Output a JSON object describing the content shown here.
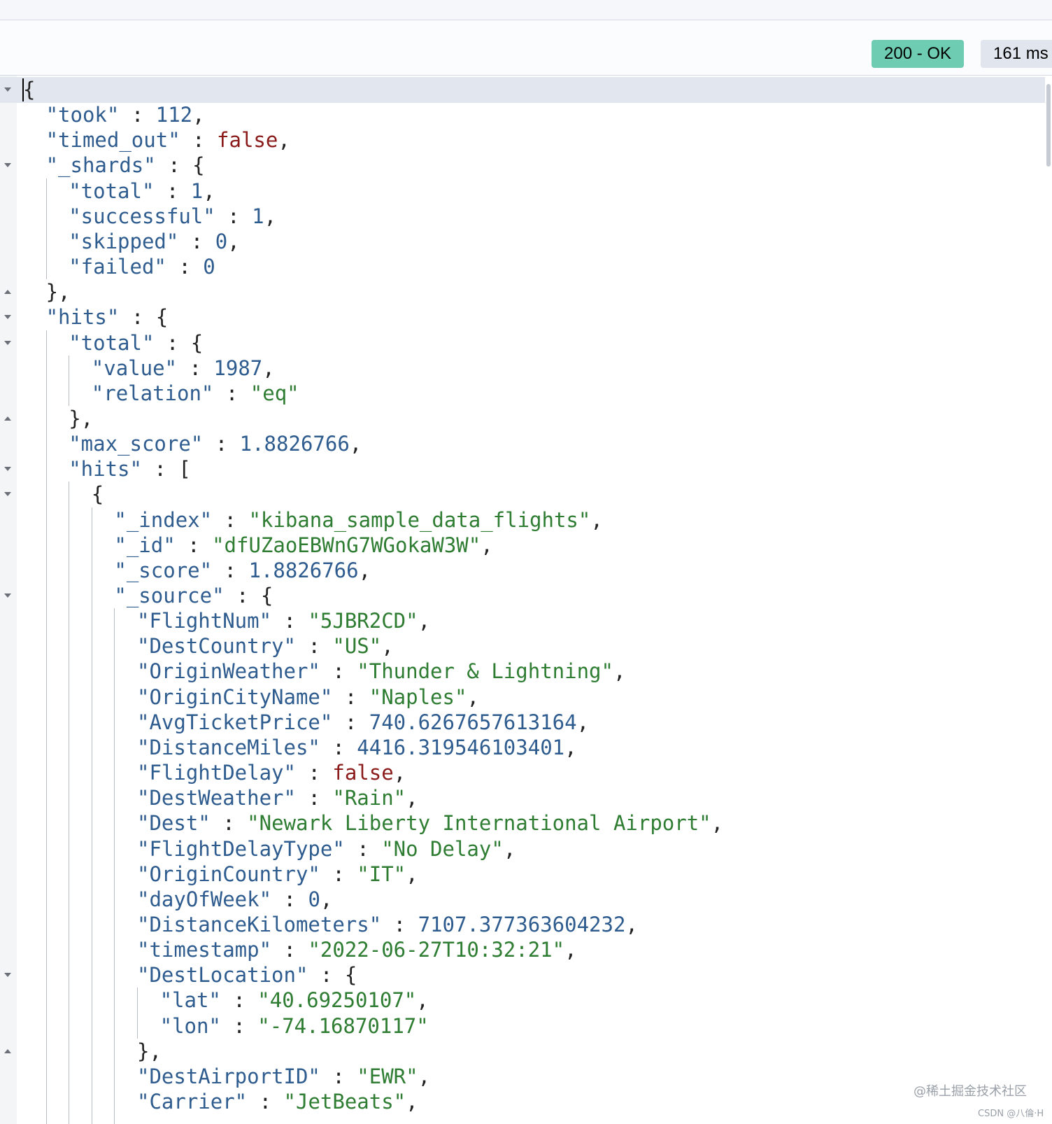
{
  "status": {
    "code_label": "200 - OK",
    "time_label": "161 ms"
  },
  "response": {
    "lines": [
      [
        [
          "p",
          "{"
        ]
      ],
      [
        [
          "k",
          "\"took\""
        ],
        [
          "p",
          " : "
        ],
        [
          "n",
          "112"
        ],
        [
          "p",
          ","
        ]
      ],
      [
        [
          "k",
          "\"timed_out\""
        ],
        [
          "p",
          " : "
        ],
        [
          "b",
          "false"
        ],
        [
          "p",
          ","
        ]
      ],
      [
        [
          "k",
          "\"_shards\""
        ],
        [
          "p",
          " : {"
        ]
      ],
      [
        [
          "k",
          "\"total\""
        ],
        [
          "p",
          " : "
        ],
        [
          "n",
          "1"
        ],
        [
          "p",
          ","
        ]
      ],
      [
        [
          "k",
          "\"successful\""
        ],
        [
          "p",
          " : "
        ],
        [
          "n",
          "1"
        ],
        [
          "p",
          ","
        ]
      ],
      [
        [
          "k",
          "\"skipped\""
        ],
        [
          "p",
          " : "
        ],
        [
          "n",
          "0"
        ],
        [
          "p",
          ","
        ]
      ],
      [
        [
          "k",
          "\"failed\""
        ],
        [
          "p",
          " : "
        ],
        [
          "n",
          "0"
        ]
      ],
      [
        [
          "p",
          "},"
        ]
      ],
      [
        [
          "k",
          "\"hits\""
        ],
        [
          "p",
          " : {"
        ]
      ],
      [
        [
          "k",
          "\"total\""
        ],
        [
          "p",
          " : {"
        ]
      ],
      [
        [
          "k",
          "\"value\""
        ],
        [
          "p",
          " : "
        ],
        [
          "n",
          "1987"
        ],
        [
          "p",
          ","
        ]
      ],
      [
        [
          "k",
          "\"relation\""
        ],
        [
          "p",
          " : "
        ],
        [
          "s",
          "\"eq\""
        ]
      ],
      [
        [
          "p",
          "},"
        ]
      ],
      [
        [
          "k",
          "\"max_score\""
        ],
        [
          "p",
          " : "
        ],
        [
          "n",
          "1.8826766"
        ],
        [
          "p",
          ","
        ]
      ],
      [
        [
          "k",
          "\"hits\""
        ],
        [
          "p",
          " : ["
        ]
      ],
      [
        [
          "p",
          "{"
        ]
      ],
      [
        [
          "k",
          "\"_index\""
        ],
        [
          "p",
          " : "
        ],
        [
          "s",
          "\"kibana_sample_data_flights\""
        ],
        [
          "p",
          ","
        ]
      ],
      [
        [
          "k",
          "\"_id\""
        ],
        [
          "p",
          " : "
        ],
        [
          "s",
          "\"dfUZaoEBWnG7WGokaW3W\""
        ],
        [
          "p",
          ","
        ]
      ],
      [
        [
          "k",
          "\"_score\""
        ],
        [
          "p",
          " : "
        ],
        [
          "n",
          "1.8826766"
        ],
        [
          "p",
          ","
        ]
      ],
      [
        [
          "k",
          "\"_source\""
        ],
        [
          "p",
          " : {"
        ]
      ],
      [
        [
          "k",
          "\"FlightNum\""
        ],
        [
          "p",
          " : "
        ],
        [
          "s",
          "\"5JBR2CD\""
        ],
        [
          "p",
          ","
        ]
      ],
      [
        [
          "k",
          "\"DestCountry\""
        ],
        [
          "p",
          " : "
        ],
        [
          "s",
          "\"US\""
        ],
        [
          "p",
          ","
        ]
      ],
      [
        [
          "k",
          "\"OriginWeather\""
        ],
        [
          "p",
          " : "
        ],
        [
          "s",
          "\"Thunder & Lightning\""
        ],
        [
          "p",
          ","
        ]
      ],
      [
        [
          "k",
          "\"OriginCityName\""
        ],
        [
          "p",
          " : "
        ],
        [
          "s",
          "\"Naples\""
        ],
        [
          "p",
          ","
        ]
      ],
      [
        [
          "k",
          "\"AvgTicketPrice\""
        ],
        [
          "p",
          " : "
        ],
        [
          "n",
          "740.6267657613164"
        ],
        [
          "p",
          ","
        ]
      ],
      [
        [
          "k",
          "\"DistanceMiles\""
        ],
        [
          "p",
          " : "
        ],
        [
          "n",
          "4416.319546103401"
        ],
        [
          "p",
          ","
        ]
      ],
      [
        [
          "k",
          "\"FlightDelay\""
        ],
        [
          "p",
          " : "
        ],
        [
          "b",
          "false"
        ],
        [
          "p",
          ","
        ]
      ],
      [
        [
          "k",
          "\"DestWeather\""
        ],
        [
          "p",
          " : "
        ],
        [
          "s",
          "\"Rain\""
        ],
        [
          "p",
          ","
        ]
      ],
      [
        [
          "k",
          "\"Dest\""
        ],
        [
          "p",
          " : "
        ],
        [
          "s",
          "\"Newark Liberty International Airport\""
        ],
        [
          "p",
          ","
        ]
      ],
      [
        [
          "k",
          "\"FlightDelayType\""
        ],
        [
          "p",
          " : "
        ],
        [
          "s",
          "\"No Delay\""
        ],
        [
          "p",
          ","
        ]
      ],
      [
        [
          "k",
          "\"OriginCountry\""
        ],
        [
          "p",
          " : "
        ],
        [
          "s",
          "\"IT\""
        ],
        [
          "p",
          ","
        ]
      ],
      [
        [
          "k",
          "\"dayOfWeek\""
        ],
        [
          "p",
          " : "
        ],
        [
          "n",
          "0"
        ],
        [
          "p",
          ","
        ]
      ],
      [
        [
          "k",
          "\"DistanceKilometers\""
        ],
        [
          "p",
          " : "
        ],
        [
          "n",
          "7107.377363604232"
        ],
        [
          "p",
          ","
        ]
      ],
      [
        [
          "k",
          "\"timestamp\""
        ],
        [
          "p",
          " : "
        ],
        [
          "s",
          "\"2022-06-27T10:32:21\""
        ],
        [
          "p",
          ","
        ]
      ],
      [
        [
          "k",
          "\"DestLocation\""
        ],
        [
          "p",
          " : {"
        ]
      ],
      [
        [
          "k",
          "\"lat\""
        ],
        [
          "p",
          " : "
        ],
        [
          "s",
          "\"40.69250107\""
        ],
        [
          "p",
          ","
        ]
      ],
      [
        [
          "k",
          "\"lon\""
        ],
        [
          "p",
          " : "
        ],
        [
          "s",
          "\"-74.16870117\""
        ]
      ],
      [
        [
          "p",
          "},"
        ]
      ],
      [
        [
          "k",
          "\"DestAirportID\""
        ],
        [
          "p",
          " : "
        ],
        [
          "s",
          "\"EWR\""
        ],
        [
          "p",
          ","
        ]
      ],
      [
        [
          "k",
          "\"Carrier\""
        ],
        [
          "p",
          " : "
        ],
        [
          "s",
          "\"JetBeats\""
        ],
        [
          "p",
          ","
        ]
      ]
    ]
  },
  "watermark": {
    "main": "@稀土掘金技术社区",
    "sub": "CSDN @八倫·H"
  },
  "colors": {
    "key": "#2f5c8f",
    "number": "#2f5c8f",
    "string": "#2e7d32",
    "boolean": "#8b1a1a",
    "status_ok_bg": "#6dccb1"
  }
}
